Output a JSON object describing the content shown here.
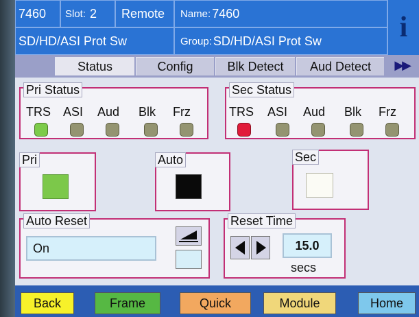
{
  "header": {
    "device_id": "7460",
    "slot_label": "Slot:",
    "slot_value": "2",
    "mode": "Remote",
    "name_label": "Name:",
    "name_value": "7460",
    "product": "SD/HD/ASI Prot Sw",
    "group_label": "Group:",
    "group_value": "SD/HD/ASI Prot Sw",
    "info_glyph": "i"
  },
  "tabs": {
    "items": [
      "Status",
      "Config",
      "Blk Detect",
      "Aud Detect"
    ],
    "active": "Status",
    "more_glyph": "▶▶"
  },
  "pri_status": {
    "title": "Pri Status",
    "indicators": [
      {
        "label": "TRS",
        "state": "green"
      },
      {
        "label": "ASI",
        "state": "off"
      },
      {
        "label": "Aud",
        "state": "off"
      },
      {
        "label": "Blk",
        "state": "off"
      },
      {
        "label": "Frz",
        "state": "off"
      }
    ]
  },
  "sec_status": {
    "title": "Sec Status",
    "indicators": [
      {
        "label": "TRS",
        "state": "red"
      },
      {
        "label": "ASI",
        "state": "off"
      },
      {
        "label": "Aud",
        "state": "off"
      },
      {
        "label": "Blk",
        "state": "off"
      },
      {
        "label": "Frz",
        "state": "off"
      }
    ]
  },
  "selectors": {
    "pri": {
      "label": "Pri",
      "color": "#7cc84a"
    },
    "auto": {
      "label": "Auto",
      "color": "#0a0a0a"
    },
    "sec": {
      "label": "Sec",
      "color": "#fbfbf5"
    }
  },
  "auto_reset": {
    "title": "Auto Reset",
    "value": "On"
  },
  "reset_time": {
    "title": "Reset Time",
    "value": "15.0",
    "unit": "secs"
  },
  "bottom_nav": {
    "back": "Back",
    "frame": "Frame",
    "quick": "Quick",
    "module": "Module",
    "home": "Home"
  },
  "colors": {
    "header": "#1e5db5",
    "group_border": "#c22f75",
    "led_green": "#7ccb4a",
    "led_red": "#e11b3a",
    "led_off": "#949471",
    "back": "#f7f12a",
    "frame": "#56b843",
    "quick": "#f2a85f",
    "module": "#f0d77a",
    "home": "#7ec8ec"
  }
}
